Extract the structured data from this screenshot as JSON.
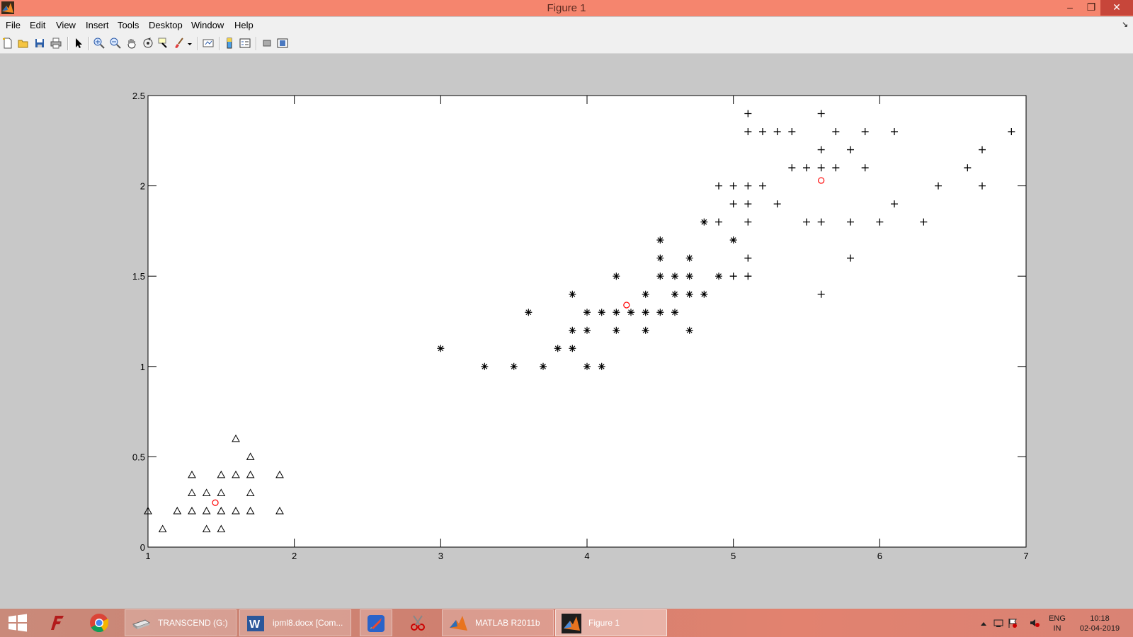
{
  "window": {
    "title": "Figure 1",
    "min": "–",
    "max": "❐",
    "close": "✕"
  },
  "menu": [
    "File",
    "Edit",
    "View",
    "Insert",
    "Tools",
    "Desktop",
    "Window",
    "Help"
  ],
  "toolbar_icons": [
    "new-figure-icon",
    "open-file-icon",
    "save-icon",
    "print-icon",
    "arrow-select-icon",
    "zoom-in-icon",
    "zoom-out-icon",
    "pan-hand-icon",
    "rotate-3d-icon",
    "data-cursor-icon",
    "brush-icon",
    "link-plot-icon",
    "colorbar-icon",
    "legend-icon",
    "hide-plot-tools-icon",
    "show-plot-tools-icon"
  ],
  "chart_data": {
    "type": "scatter",
    "xlim": [
      1,
      7
    ],
    "ylim": [
      0,
      2.5
    ],
    "xticks": [
      "1",
      "2",
      "3",
      "4",
      "5",
      "6",
      "7"
    ],
    "yticks": [
      "0",
      "0.5",
      "1",
      "1.5",
      "2",
      "2.5"
    ],
    "grid": false,
    "series": [
      {
        "marker": "triangle",
        "color": "#000000",
        "points": [
          [
            1.0,
            0.2
          ],
          [
            1.1,
            0.1
          ],
          [
            1.2,
            0.2
          ],
          [
            1.3,
            0.4
          ],
          [
            1.3,
            0.3
          ],
          [
            1.3,
            0.2
          ],
          [
            1.4,
            0.3
          ],
          [
            1.4,
            0.2
          ],
          [
            1.4,
            0.1
          ],
          [
            1.5,
            0.4
          ],
          [
            1.5,
            0.3
          ],
          [
            1.5,
            0.2
          ],
          [
            1.5,
            0.1
          ],
          [
            1.6,
            0.6
          ],
          [
            1.6,
            0.4
          ],
          [
            1.6,
            0.2
          ],
          [
            1.7,
            0.5
          ],
          [
            1.7,
            0.4
          ],
          [
            1.7,
            0.3
          ],
          [
            1.7,
            0.2
          ],
          [
            1.9,
            0.4
          ],
          [
            1.9,
            0.2
          ]
        ]
      },
      {
        "marker": "asterisk",
        "color": "#000000",
        "points": [
          [
            3.0,
            1.1
          ],
          [
            3.3,
            1.0
          ],
          [
            3.5,
            1.0
          ],
          [
            3.6,
            1.3
          ],
          [
            3.7,
            1.0
          ],
          [
            3.8,
            1.1
          ],
          [
            3.9,
            1.4
          ],
          [
            3.9,
            1.2
          ],
          [
            3.9,
            1.1
          ],
          [
            4.0,
            1.3
          ],
          [
            4.0,
            1.2
          ],
          [
            4.0,
            1.0
          ],
          [
            4.1,
            1.3
          ],
          [
            4.1,
            1.0
          ],
          [
            4.2,
            1.5
          ],
          [
            4.2,
            1.3
          ],
          [
            4.2,
            1.2
          ],
          [
            4.3,
            1.3
          ],
          [
            4.4,
            1.4
          ],
          [
            4.4,
            1.3
          ],
          [
            4.4,
            1.2
          ],
          [
            4.5,
            1.7
          ],
          [
            4.5,
            1.6
          ],
          [
            4.5,
            1.5
          ],
          [
            4.5,
            1.3
          ],
          [
            4.6,
            1.5
          ],
          [
            4.6,
            1.4
          ],
          [
            4.6,
            1.3
          ],
          [
            4.7,
            1.6
          ],
          [
            4.7,
            1.5
          ],
          [
            4.7,
            1.4
          ],
          [
            4.7,
            1.2
          ],
          [
            4.8,
            1.8
          ],
          [
            4.8,
            1.4
          ],
          [
            4.9,
            1.5
          ],
          [
            5.0,
            1.7
          ]
        ]
      },
      {
        "marker": "plus",
        "color": "#000000",
        "points": [
          [
            4.9,
            2.0
          ],
          [
            4.9,
            1.8
          ],
          [
            5.0,
            2.0
          ],
          [
            5.0,
            1.9
          ],
          [
            5.0,
            1.5
          ],
          [
            5.1,
            2.4
          ],
          [
            5.1,
            2.3
          ],
          [
            5.1,
            2.0
          ],
          [
            5.1,
            1.9
          ],
          [
            5.1,
            1.8
          ],
          [
            5.1,
            1.6
          ],
          [
            5.1,
            1.5
          ],
          [
            5.2,
            2.3
          ],
          [
            5.2,
            2.0
          ],
          [
            5.3,
            2.3
          ],
          [
            5.3,
            1.9
          ],
          [
            5.4,
            2.3
          ],
          [
            5.4,
            2.1
          ],
          [
            5.5,
            2.1
          ],
          [
            5.5,
            1.8
          ],
          [
            5.6,
            2.4
          ],
          [
            5.6,
            2.2
          ],
          [
            5.6,
            2.1
          ],
          [
            5.6,
            1.8
          ],
          [
            5.6,
            1.4
          ],
          [
            5.7,
            2.3
          ],
          [
            5.7,
            2.1
          ],
          [
            5.8,
            2.2
          ],
          [
            5.8,
            1.8
          ],
          [
            5.8,
            1.6
          ],
          [
            5.9,
            2.3
          ],
          [
            5.9,
            2.1
          ],
          [
            6.0,
            1.8
          ],
          [
            6.1,
            2.3
          ],
          [
            6.1,
            1.9
          ],
          [
            6.3,
            1.8
          ],
          [
            6.4,
            2.0
          ],
          [
            6.6,
            2.1
          ],
          [
            6.7,
            2.2
          ],
          [
            6.7,
            2.0
          ],
          [
            6.9,
            2.3
          ]
        ]
      },
      {
        "marker": "circle",
        "color": "#ff0000",
        "points": [
          [
            1.46,
            0.246
          ],
          [
            4.27,
            1.34
          ],
          [
            5.6,
            2.03
          ]
        ]
      }
    ]
  },
  "taskbar": {
    "apps": [
      {
        "icon": "windows-start-icon"
      },
      {
        "icon": "foxit-reader-icon"
      },
      {
        "icon": "chrome-icon"
      },
      {
        "icon": "drive-icon",
        "label": "TRANSCEND (G:)"
      },
      {
        "icon": "word-icon",
        "label": "ipml8.docx [Com..."
      },
      {
        "icon": "rocket-app-icon"
      },
      {
        "icon": "snipping-tool-icon"
      },
      {
        "icon": "matlab-icon",
        "label": "MATLAB  R2011b"
      },
      {
        "icon": "matlab-figure-icon",
        "label": "Figure 1"
      }
    ],
    "tray": {
      "lang": "ENG",
      "region": "IN",
      "time": "10:18",
      "date": "02-04-2019"
    }
  }
}
